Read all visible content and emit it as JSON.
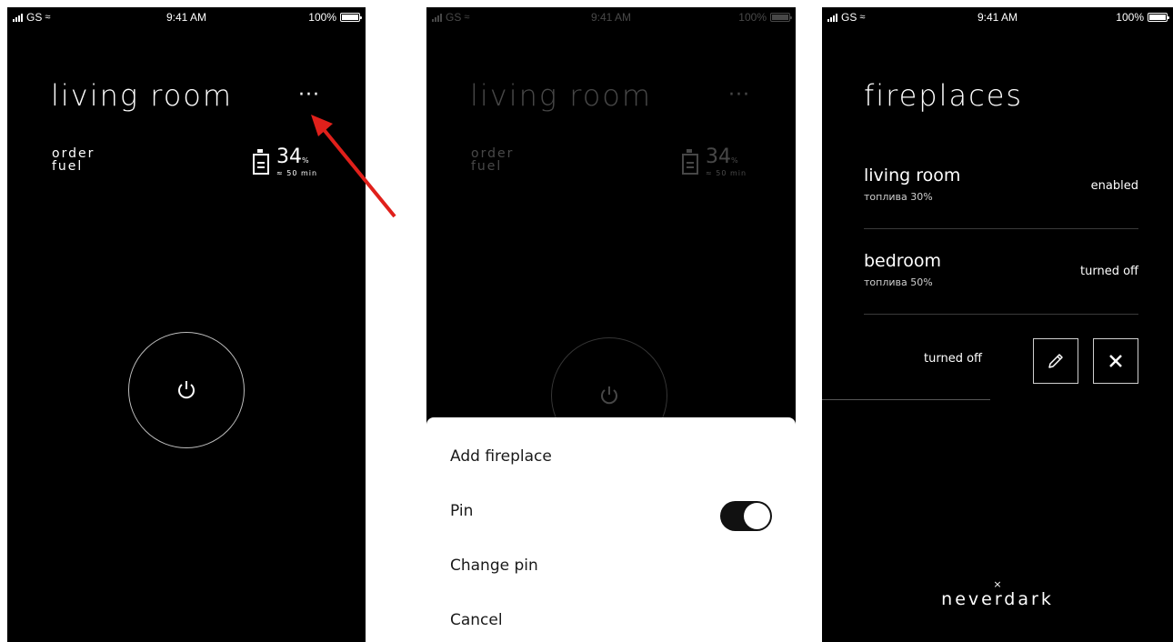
{
  "status_bar": {
    "carrier": "GS",
    "time": "9:41 AM",
    "battery": "100%"
  },
  "room_screen": {
    "title": "living room",
    "more_label": "···",
    "order_fuel": "order\nfuel",
    "fuel_percent": "34",
    "fuel_unit": "%",
    "fuel_time": "≈ 50 min"
  },
  "action_sheet": {
    "items": [
      {
        "label": "Add fireplace"
      },
      {
        "label": "Pin",
        "toggle_on": true
      },
      {
        "label": "Change pin"
      },
      {
        "label": "Cancel"
      }
    ]
  },
  "fireplaces_screen": {
    "title": "fireplaces",
    "rows": [
      {
        "name": "living room",
        "fuel": "топлива 30%",
        "status": "enabled"
      },
      {
        "name": "bedroom",
        "fuel": "топлива 50%",
        "status": "turned off"
      }
    ],
    "swiped_row_status": "turned off",
    "brand": {
      "mark": "×",
      "word": "neverdark"
    }
  },
  "colors": {
    "background": "#000000",
    "sheet": "#ffffff",
    "arrow": "#e0201b",
    "divider": "#3a3a3a"
  },
  "icons": [
    "signal-icon",
    "wifi-icon",
    "battery-icon",
    "fuel-canister-icon",
    "power-icon",
    "pencil-icon",
    "close-icon"
  ]
}
